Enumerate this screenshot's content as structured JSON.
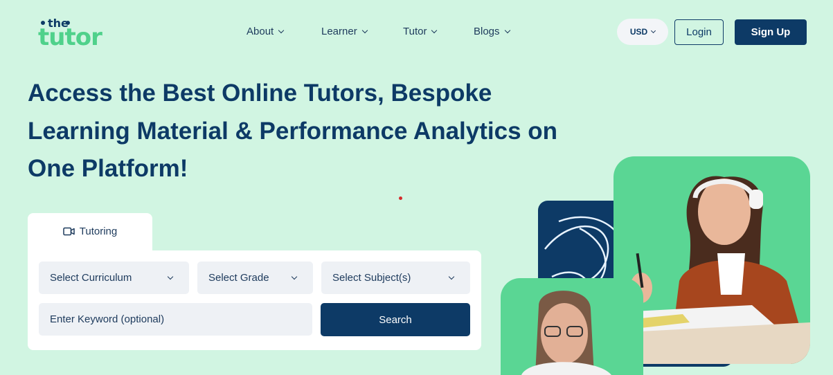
{
  "logo": {
    "line1": "the",
    "line2": "tutor"
  },
  "nav": {
    "items": [
      {
        "label": "About"
      },
      {
        "label": "Learner"
      },
      {
        "label": "Tutor"
      },
      {
        "label": "Blogs"
      }
    ]
  },
  "header": {
    "currency": "USD",
    "login_label": "Login",
    "signup_label": "Sign Up"
  },
  "hero": {
    "line1": "Access the Best Online Tutors, Bespoke",
    "line2": "Learning Material & Performance Analytics on",
    "line3": "One Platform!"
  },
  "search": {
    "tab_label": "Tutoring",
    "tab_icon": "video-camera-icon",
    "curriculum_label": "Select Curriculum",
    "grade_label": "Select Grade",
    "subject_label": "Select Subject(s)",
    "keyword_placeholder": "Enter Keyword (optional)",
    "search_label": "Search"
  },
  "colors": {
    "background": "#d1f5e2",
    "navy": "#0d3a66",
    "green": "#5ad694"
  }
}
